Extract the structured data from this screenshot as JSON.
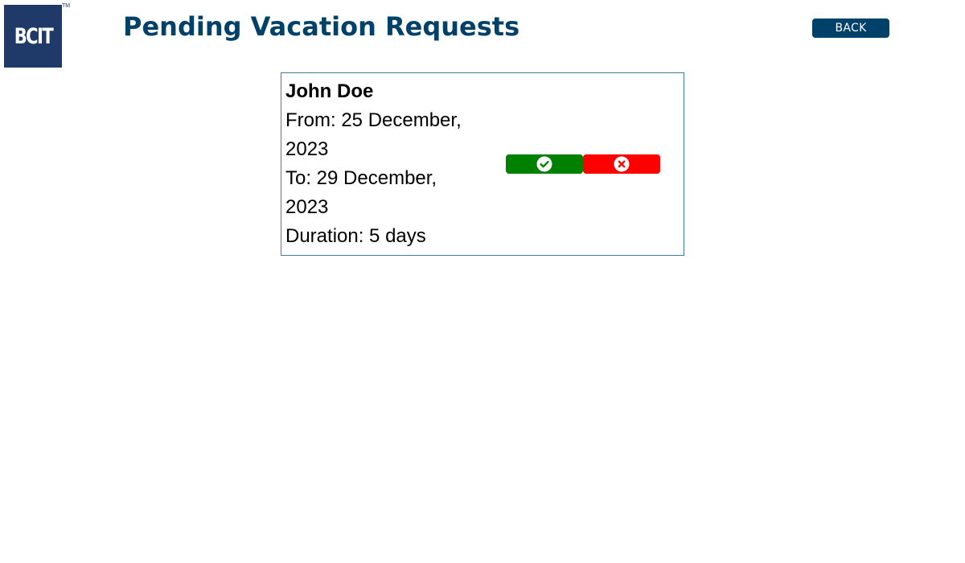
{
  "header": {
    "logo_text": "BCIT",
    "logo_tm": "TM",
    "title": "Pending Vacation Requests",
    "back_label": "BACK"
  },
  "requests": [
    {
      "name": "John Doe",
      "from_line1": "From: 25 December,",
      "from_line2": "2023",
      "to_line1": "To: 29 December,",
      "to_line2": "2023",
      "duration": "Duration: 5 days",
      "approve_icon": "check-circle-icon",
      "deny_icon": "x-circle-icon"
    }
  ],
  "colors": {
    "title": "#00416a",
    "back_button": "#00416a",
    "logo": "#1f3a68",
    "approve": "#008000",
    "deny": "#ff0000",
    "card_border": "#3f7f9a"
  }
}
